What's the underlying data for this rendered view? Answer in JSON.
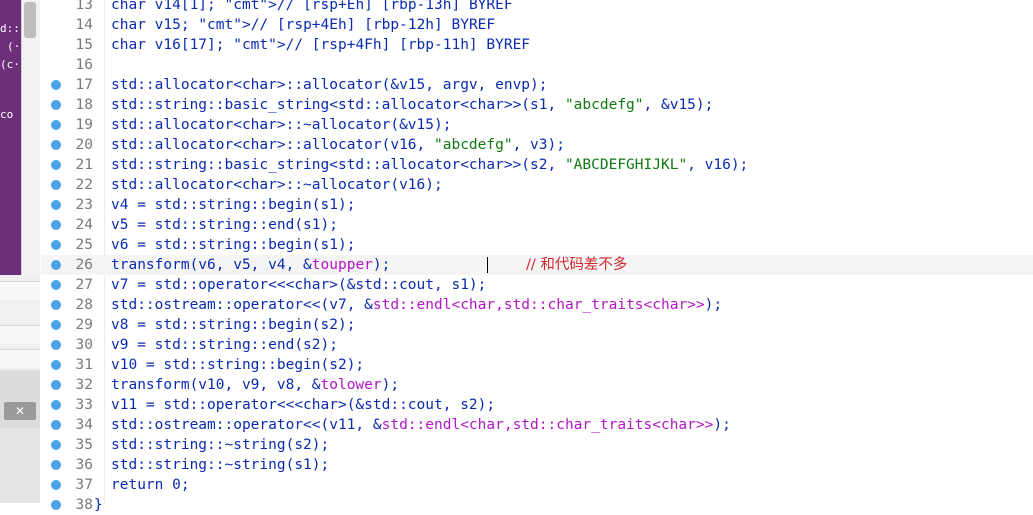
{
  "theme": {
    "code_color": "#0a2bb0",
    "string_color": "#0f7a0f",
    "import_color": "#b316c6",
    "comment_color": "#1c64b4",
    "breakpoint_color": "#4aa3e8",
    "sidebar_accent": "#6d2f7a"
  },
  "sidebar": {
    "fragments": [
      "d::",
      "(·",
      "(c·",
      "co"
    ],
    "close_label": "✕"
  },
  "editor": {
    "lines": [
      {
        "num": "13",
        "text": "char v14[1]; // [rsp+Eh] [rbp-13h] BYREF",
        "bp": false
      },
      {
        "num": "14",
        "text": "char v15; // [rsp+4Eh] [rbp-12h] BYREF",
        "bp": false
      },
      {
        "num": "15",
        "text": "char v16[17]; // [rsp+4Fh] [rbp-11h] BYREF",
        "bp": false
      },
      {
        "num": "16",
        "text": "",
        "bp": false
      },
      {
        "num": "17",
        "text": "std::allocator<char>::allocator(&v15, argv, envp);",
        "bp": true
      },
      {
        "num": "18",
        "text": "std::string::basic_string<std::allocator<char>>(s1, \"abcdefg\", &v15);",
        "bp": true
      },
      {
        "num": "19",
        "text": "std::allocator<char>::~allocator(&v15);",
        "bp": true
      },
      {
        "num": "20",
        "text": "std::allocator<char>::allocator(v16, \"abcdefg\", v3);",
        "bp": true
      },
      {
        "num": "21",
        "text": "std::string::basic_string<std::allocator<char>>(s2, \"ABCDEFGHIJKL\", v16);",
        "bp": true
      },
      {
        "num": "22",
        "text": "std::allocator<char>::~allocator(v16);",
        "bp": true
      },
      {
        "num": "23",
        "text": "v4 = std::string::begin(s1);",
        "bp": true
      },
      {
        "num": "24",
        "text": "v5 = std::string::end(s1);",
        "bp": true
      },
      {
        "num": "25",
        "text": "v6 = std::string::begin(s1);",
        "bp": true
      },
      {
        "num": "26",
        "text": "transform(v6, v5, v4, &toupper);",
        "bp": true,
        "comment": "// 和代码差不多",
        "current": true
      },
      {
        "num": "27",
        "text": "v7 = std::operator<<<char>(&std::cout, s1);",
        "bp": true
      },
      {
        "num": "28",
        "text": "std::ostream::operator<<(v7, &std::endl<char,std::char_traits<char>>);",
        "bp": true
      },
      {
        "num": "29",
        "text": "v8 = std::string::begin(s2);",
        "bp": true
      },
      {
        "num": "30",
        "text": "v9 = std::string::end(s2);",
        "bp": true
      },
      {
        "num": "31",
        "text": "v10 = std::string::begin(s2);",
        "bp": true
      },
      {
        "num": "32",
        "text": "transform(v10, v9, v8, &tolower);",
        "bp": true
      },
      {
        "num": "33",
        "text": "v11 = std::operator<<<char>(&std::cout, s2);",
        "bp": true
      },
      {
        "num": "34",
        "text": "std::ostream::operator<<(v11, &std::endl<char,std::char_traits<char>>);",
        "bp": true
      },
      {
        "num": "35",
        "text": "std::string::~string(s2);",
        "bp": true
      },
      {
        "num": "36",
        "text": "std::string::~string(s1);",
        "bp": true
      },
      {
        "num": "37",
        "text": "return 0;",
        "bp": true
      },
      {
        "num": "38",
        "text": "}",
        "bp": true,
        "outdent": true
      }
    ]
  }
}
